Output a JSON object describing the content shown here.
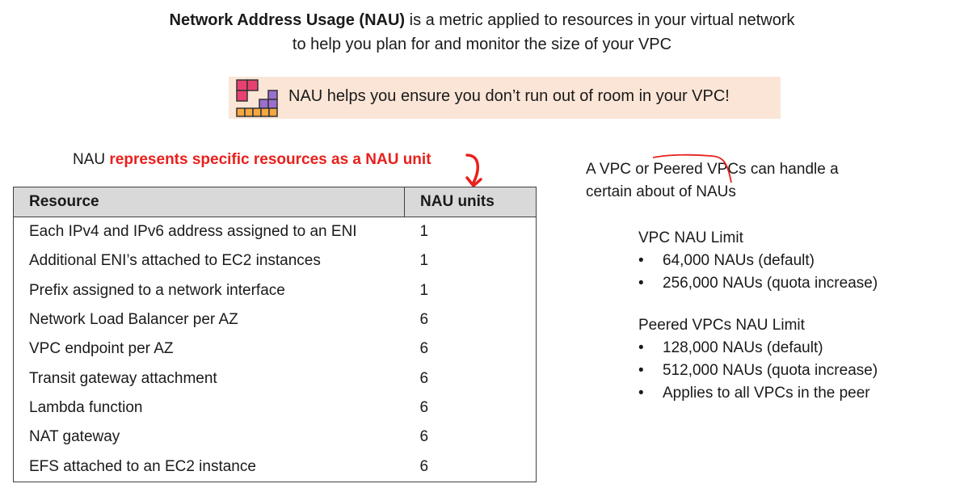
{
  "intro": {
    "bold": "Network Address Usage (NAU)",
    "line1_rest": " is a metric applied to resources in your virtual network",
    "line2": "to help you plan for and monitor the size of your VPC"
  },
  "callout": {
    "text": "NAU helps you ensure you don’t run out of room in your VPC!",
    "icon": "stacked-blocks-icon"
  },
  "nau_line": {
    "plain": "NAU ",
    "highlight": "represents specific resources as a NAU unit",
    "highlight_color": "#e8201c"
  },
  "table": {
    "headers": [
      "Resource",
      "NAU units"
    ],
    "rows": [
      {
        "resource": "Each IPv4 and IPv6 address assigned to an ENI",
        "units": "1"
      },
      {
        "resource": "Additional ENI’s attached to EC2 instances",
        "units": "1"
      },
      {
        "resource": "Prefix assigned to a network interface",
        "units": "1"
      },
      {
        "resource": "Network Load Balancer per AZ",
        "units": "6"
      },
      {
        "resource": "VPC endpoint per AZ",
        "units": "6"
      },
      {
        "resource": "Transit gateway attachment",
        "units": "6"
      },
      {
        "resource": "Lambda function",
        "units": "6"
      },
      {
        "resource": "NAT gateway",
        "units": "6"
      },
      {
        "resource": "EFS attached to an EC2 instance",
        "units": "6"
      }
    ]
  },
  "right": {
    "line1_a": "A VPC or ",
    "line1_peered": "Peered",
    "line1_b": " VPCs can handle a",
    "line2": "certain about of NAUs",
    "vpc_limit": {
      "title": "VPC NAU Limit",
      "items": [
        "64,000 NAUs  (default)",
        "256,000 NAUs (quota increase)"
      ]
    },
    "peered_limit": {
      "title": "Peered VPCs NAU Limit",
      "items": [
        "128,000 NAUs  (default)",
        "512,000 NAUs (quota increase)",
        "Applies to all VPCs in the peer"
      ]
    }
  },
  "colors": {
    "callout_bg": "#fbe5d6",
    "header_bg": "#d9d9d9",
    "accent_red": "#e8201c",
    "block_red": "#e8416f",
    "block_purple": "#9b6fcf",
    "block_orange": "#f5a742"
  }
}
